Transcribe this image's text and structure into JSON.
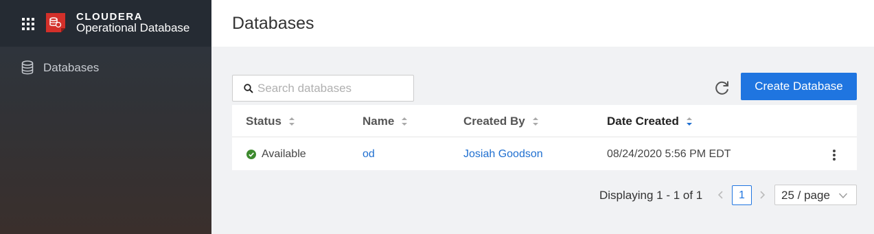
{
  "brand": {
    "name": "CLOUDERA",
    "product": "Operational Database",
    "logo_color": "#d3302a"
  },
  "sidebar": {
    "items": [
      {
        "label": "Databases",
        "icon": "database-icon"
      }
    ]
  },
  "header": {
    "title": "Databases"
  },
  "toolbar": {
    "search_placeholder": "Search databases",
    "search_value": "",
    "create_label": "Create Database",
    "accent_color": "#1f75e0"
  },
  "table": {
    "columns": [
      {
        "label": "Status",
        "sort": "none"
      },
      {
        "label": "Name",
        "sort": "none"
      },
      {
        "label": "Created By",
        "sort": "none"
      },
      {
        "label": "Date Created",
        "sort": "descending"
      }
    ],
    "rows": [
      {
        "status": "Available",
        "status_color": "#3d8a2e",
        "name": "od",
        "created_by": "Josiah Goodson",
        "date_created": "08/24/2020 5:56 PM EDT"
      }
    ]
  },
  "pagination": {
    "summary": "Displaying 1 - 1 of 1",
    "current_page": "1",
    "page_size": "25 / page"
  }
}
